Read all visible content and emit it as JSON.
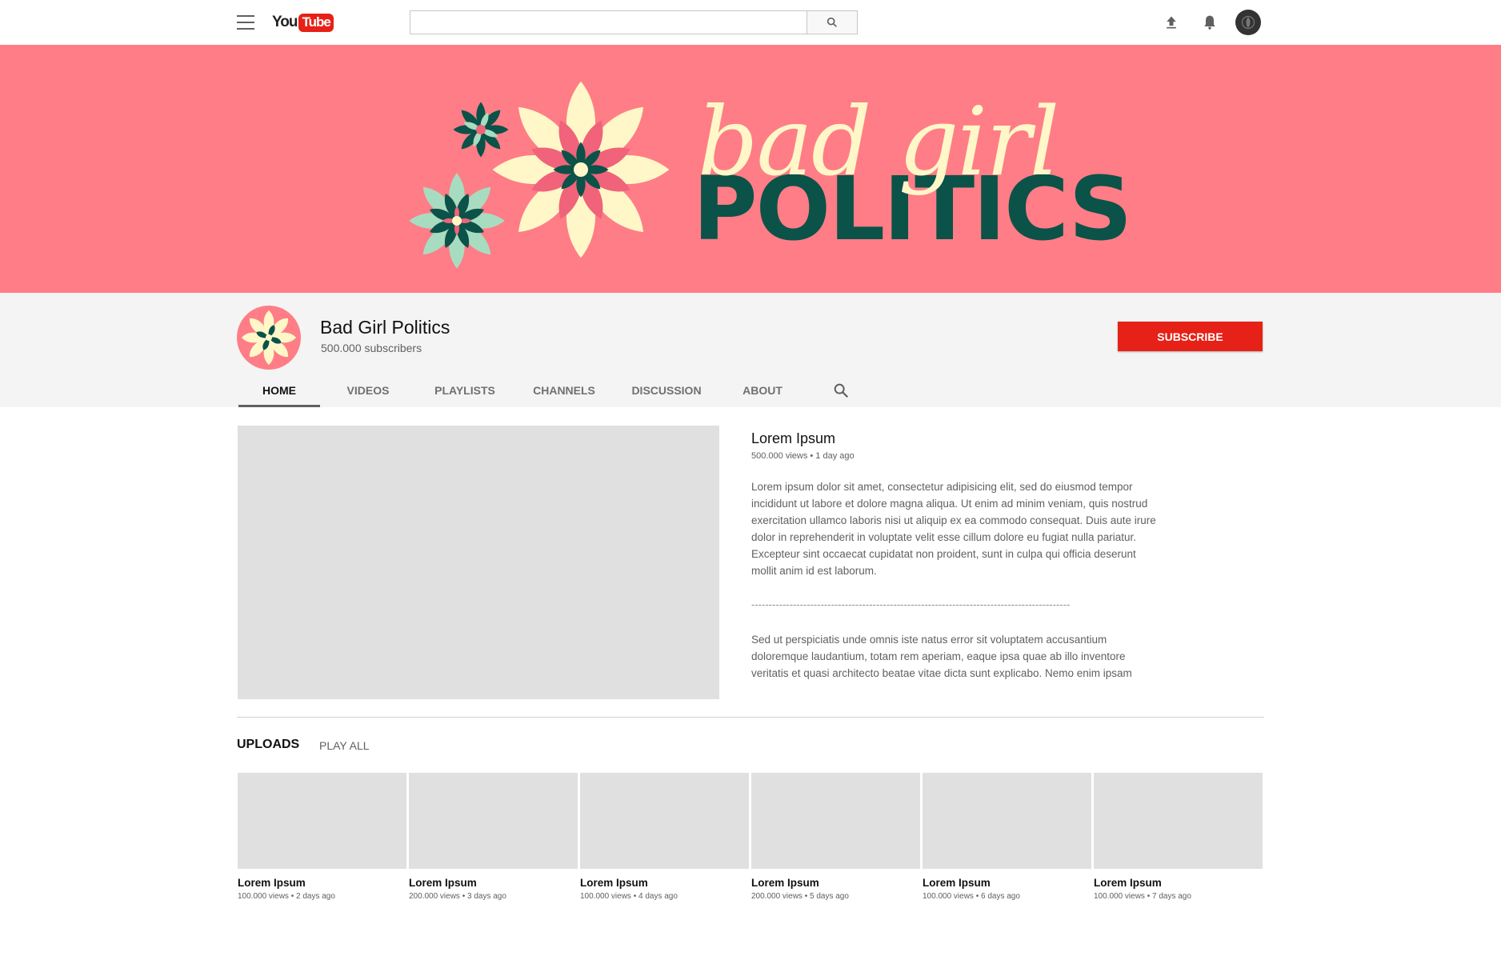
{
  "header": {
    "logo_you": "You",
    "logo_tube": "Tube",
    "search_placeholder": "",
    "icons": [
      "menu-icon",
      "search-icon",
      "upload-icon",
      "notifications-bell-icon",
      "account-avatar"
    ]
  },
  "banner": {
    "script_text": "bad girl",
    "bold_text": "POLITICS",
    "background_color": "#ff7d86",
    "script_color": "#fff7c8",
    "bold_color": "#0b5249"
  },
  "channel": {
    "name": "Bad Girl Politics",
    "subscribers": "500.000 subscribers",
    "subscribe_label": "SUBSCRIBE",
    "subscribe_color": "#e62117"
  },
  "tabs": [
    {
      "label": "HOME",
      "active": true
    },
    {
      "label": "VIDEOS",
      "active": false
    },
    {
      "label": "PLAYLISTS",
      "active": false
    },
    {
      "label": "CHANNELS",
      "active": false
    },
    {
      "label": "DISCUSSION",
      "active": false
    },
    {
      "label": "ABOUT",
      "active": false
    }
  ],
  "featured": {
    "title": "Lorem Ipsum",
    "meta": "500.000 views • 1 day ago",
    "description": "Lorem ipsum dolor sit amet, consectetur adipisicing elit, sed do eiusmod tempor incididunt ut labore et dolore magna aliqua. Ut enim ad minim veniam, quis nostrud exercitation ullamco laboris nisi ut aliquip ex ea commodo consequat. Duis aute irure dolor in reprehenderit in voluptate velit esse cillum dolore eu fugiat nulla pariatur. Excepteur sint occaecat cupidatat non proident, sunt in culpa qui officia deserunt mollit anim id est laborum.",
    "separator": "--------------------------------------------------------------------------------------------",
    "description2": "Sed ut perspiciatis unde omnis iste natus error sit voluptatem accusantium doloremque laudantium, totam rem aperiam, eaque ipsa quae ab illo inventore veritatis et quasi architecto beatae vitae dicta sunt explicabo. Nemo enim ipsam"
  },
  "uploads": {
    "title": "UPLOADS",
    "play_all": "PLAY ALL",
    "videos": [
      {
        "title": "Lorem Ipsum",
        "meta": "100.000 views • 2 days ago"
      },
      {
        "title": "Lorem Ipsum",
        "meta": "200.000 views • 3 days ago"
      },
      {
        "title": "Lorem Ipsum",
        "meta": "100.000 views • 4 days ago"
      },
      {
        "title": "Lorem Ipsum",
        "meta": "200.000 views • 5 days ago"
      },
      {
        "title": "Lorem Ipsum",
        "meta": "100.000 views • 6 days ago"
      },
      {
        "title": "Lorem Ipsum",
        "meta": "100.000 views • 7 days ago"
      }
    ]
  }
}
